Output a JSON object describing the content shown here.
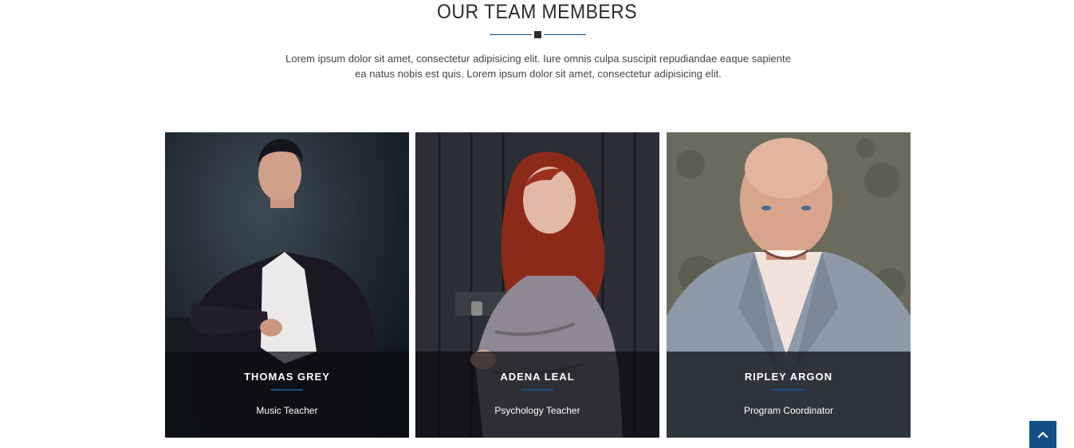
{
  "section": {
    "title": "OUR TEAM MEMBERS",
    "intro": "Lorem ipsum dolor sit amet, consectetur adipisicing elit. Iure omnis culpa suscipit repudiandae eaque sapiente ea natus nobis est quis. Lorem ipsum dolor sit amet, consectetur adipisicing elit."
  },
  "team": [
    {
      "name": "THOMAS GREY",
      "role": "Music Teacher"
    },
    {
      "name": "ADENA LEAL",
      "role": "Psychology Teacher"
    },
    {
      "name": "RIPLEY ARGON",
      "role": "Program Coordinator"
    }
  ],
  "back_to_top": {
    "icon": "chevron-up-icon"
  },
  "colors": {
    "accent": "#134f86",
    "heading": "#2b2b2b",
    "body_text": "#444444",
    "caption_overlay": "rgba(10,12,16,0.72)"
  }
}
